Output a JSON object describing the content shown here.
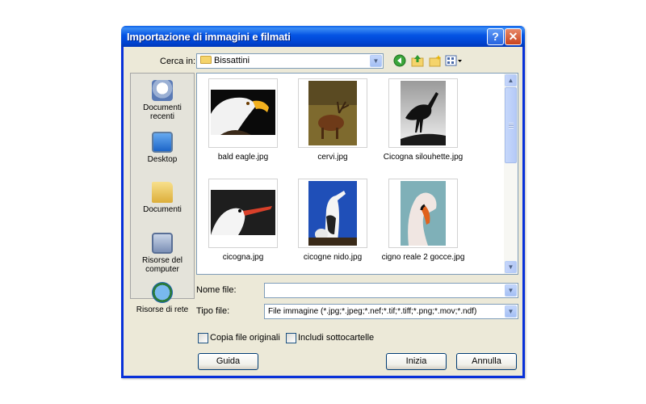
{
  "window": {
    "title": "Importazione di immagini e filmati",
    "help_glyph": "?",
    "close_glyph": "✕"
  },
  "lookin": {
    "label": "Cerca in:",
    "value": "Bissattini"
  },
  "toolbar": {
    "back_icon": "back-icon",
    "up_icon": "up-folder-icon",
    "new_folder_icon": "new-folder-icon",
    "views_icon": "views-menu-icon"
  },
  "places": [
    {
      "label": "Documenti recenti",
      "icon": "recent-documents-icon"
    },
    {
      "label": "Desktop",
      "icon": "desktop-icon"
    },
    {
      "label": "Documenti",
      "icon": "documents-icon"
    },
    {
      "label": "Risorse del computer",
      "icon": "my-computer-icon"
    },
    {
      "label": "Risorse di rete",
      "icon": "network-places-icon"
    }
  ],
  "files": [
    {
      "name": "bald eagle.jpg"
    },
    {
      "name": "cervi.jpg"
    },
    {
      "name": "Cicogna silouhette.jpg"
    },
    {
      "name": "cicogna.jpg"
    },
    {
      "name": "cicogne nido.jpg"
    },
    {
      "name": "cigno reale 2 gocce.jpg"
    }
  ],
  "filename": {
    "label": "Nome file:",
    "value": ""
  },
  "filetype": {
    "label": "Tipo file:",
    "value": "File immagine (*.jpg;*.jpeg;*.nef;*.tif;*.tiff;*.png;*.mov;*.ndf)"
  },
  "options": {
    "copy_label": "Copia file originali",
    "subfolders_label": "Includi sottocartelle"
  },
  "buttons": {
    "help": "Guida",
    "start": "Inizia",
    "cancel": "Annulla"
  },
  "colors": {
    "titlebar": "#0453e4",
    "frame": "#0831d9",
    "dialog_bg": "#ece9d8"
  }
}
